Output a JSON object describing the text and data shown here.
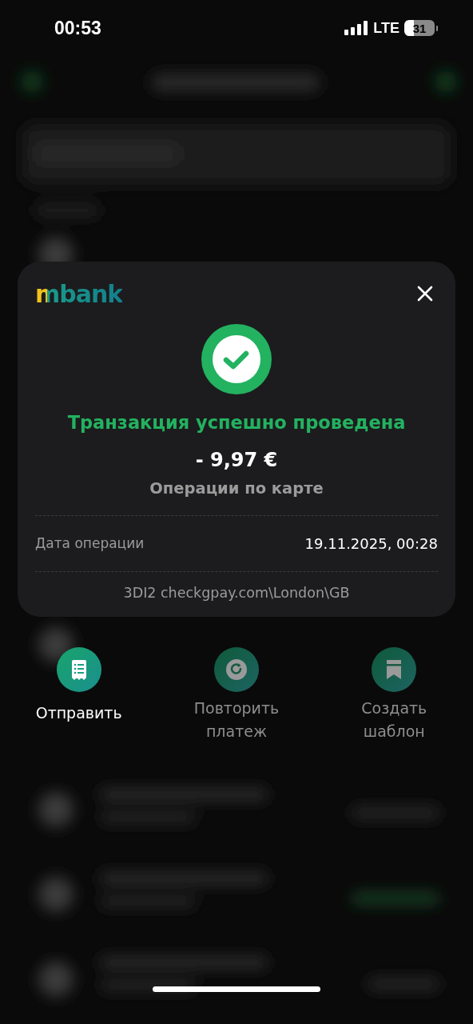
{
  "status_bar": {
    "time": "00:53",
    "network": "LTE",
    "battery": "31"
  },
  "receipt": {
    "logo": "mbank",
    "title": "Транзакция успешно проведена",
    "amount": "- 9,97 €",
    "subtitle": "Операции по карте",
    "details": [
      {
        "label": "Дата операции",
        "value": "19.11.2025, 00:28"
      }
    ],
    "merchant": "3DI2 checkgpay.com\\London\\GB"
  },
  "actions": [
    {
      "kind": "send",
      "label": "Отправить",
      "disabled": false
    },
    {
      "kind": "repeat",
      "label": "Повторить платеж",
      "disabled": true
    },
    {
      "kind": "template",
      "label": "Создать шаблон",
      "disabled": true
    }
  ]
}
